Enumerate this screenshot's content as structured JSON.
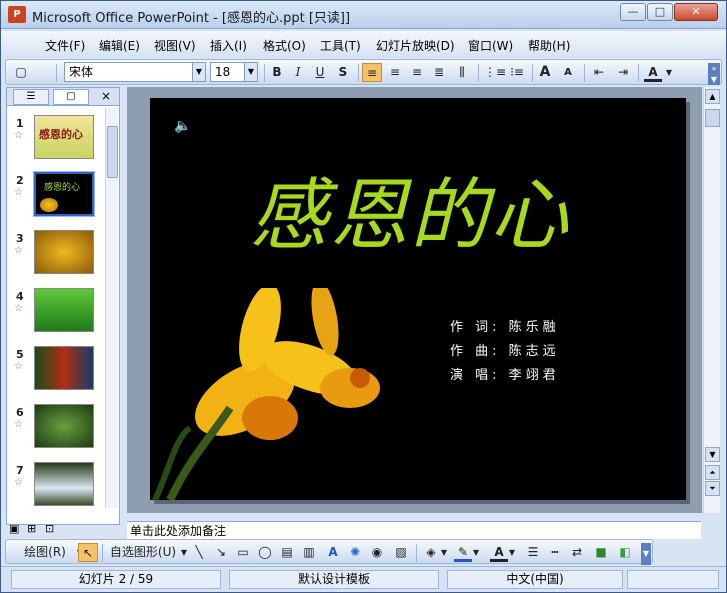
{
  "window": {
    "title": "Microsoft Office PowerPoint - [感恩的心.ppt [只读]]",
    "app_icon_label": "P",
    "btn_min": "—",
    "btn_max": "□",
    "btn_close": "✕"
  },
  "menubar": {
    "items": [
      "文件(F)",
      "编辑(E)",
      "视图(V)",
      "插入(I)",
      "格式(O)",
      "工具(T)",
      "幻灯片放映(D)",
      "窗口(W)",
      "帮助(H)"
    ],
    "close": "✕"
  },
  "toolbar": {
    "font": "宋体",
    "size": "18",
    "bold": "B",
    "italic": "I",
    "underline": "U",
    "shadow": "S",
    "increase_font": "A",
    "decrease_font": "A",
    "font_color": "A"
  },
  "panel": {
    "tab_outline": "☰",
    "tab_slides": "▢",
    "close": "×"
  },
  "slides": [
    {
      "num": "1",
      "star": "☆"
    },
    {
      "num": "2",
      "star": "☆"
    },
    {
      "num": "3",
      "star": "☆"
    },
    {
      "num": "4",
      "star": "☆"
    },
    {
      "num": "5",
      "star": "☆"
    },
    {
      "num": "6",
      "star": "☆"
    },
    {
      "num": "7",
      "star": "☆"
    }
  ],
  "slide": {
    "title": "感恩的心",
    "lyrics": "作 词: 陈乐融",
    "music": "作 曲: 陈志远",
    "singer": "演 唱: 李翊君",
    "thumb1_title": "感恩的心",
    "thumb2_title": "感恩的心"
  },
  "notes": {
    "placeholder": "单击此处添加备注"
  },
  "drawbar": {
    "draw": "绘图(R)",
    "autoshapes": "自选图形(U)"
  },
  "status": {
    "slide": "幻灯片 2 / 59",
    "design": "默认设计模板",
    "language": "中文(中国)"
  },
  "colors": {
    "title_green": "#a7d91c",
    "slide_bg": "#000000",
    "accent": "#2f63c6"
  }
}
